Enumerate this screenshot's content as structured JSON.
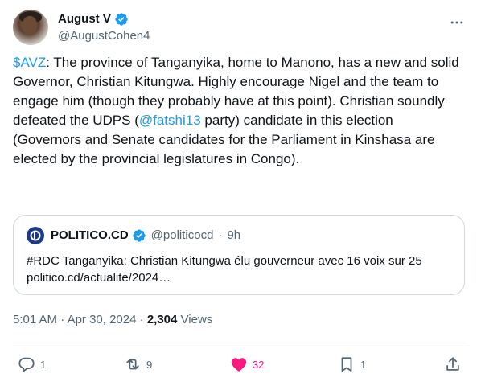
{
  "author": {
    "display_name": "August V",
    "handle": "@AugustCohen4"
  },
  "tweet": {
    "text_parts": {
      "p1": "$AVZ",
      "p2": ": The province of Tanganyika, home to Manono, has a new and solid Governor, Christian Kitungwa. Highly encourage Nigel and the team to engage him (though they probably have at this point). Christian soundly defeated the UDPS (",
      "p3": "@fatshi13",
      "p4": " party) candidate in this election (Governors and Senate candidates for the Parliament in Kinshasa are elected by the provincial legislatures in Congo)."
    }
  },
  "quote": {
    "name": "POLITICO.CD",
    "handle": "@politicocd",
    "separator": "·",
    "time": "9h",
    "text": "#RDC Tanganyika: Christian Kitungwa élu gouverneur avec 16 voix sur 25 politico.cd/actualite/2024…"
  },
  "meta": {
    "time": "5:01 AM",
    "separator": "·",
    "date": "Apr 30, 2024",
    "views_count": "2,304",
    "views_label": "Views"
  },
  "actions": {
    "replies": "1",
    "reposts": "9",
    "likes": "32",
    "bookmarks": "1"
  },
  "colors": {
    "accent": "#1d9bf0",
    "like": "#f91880",
    "secondary_text": "#536471"
  },
  "icons": [
    "verified-badge-icon",
    "more-icon",
    "reply-icon",
    "repost-icon",
    "heart-icon",
    "bookmark-icon",
    "share-icon"
  ]
}
